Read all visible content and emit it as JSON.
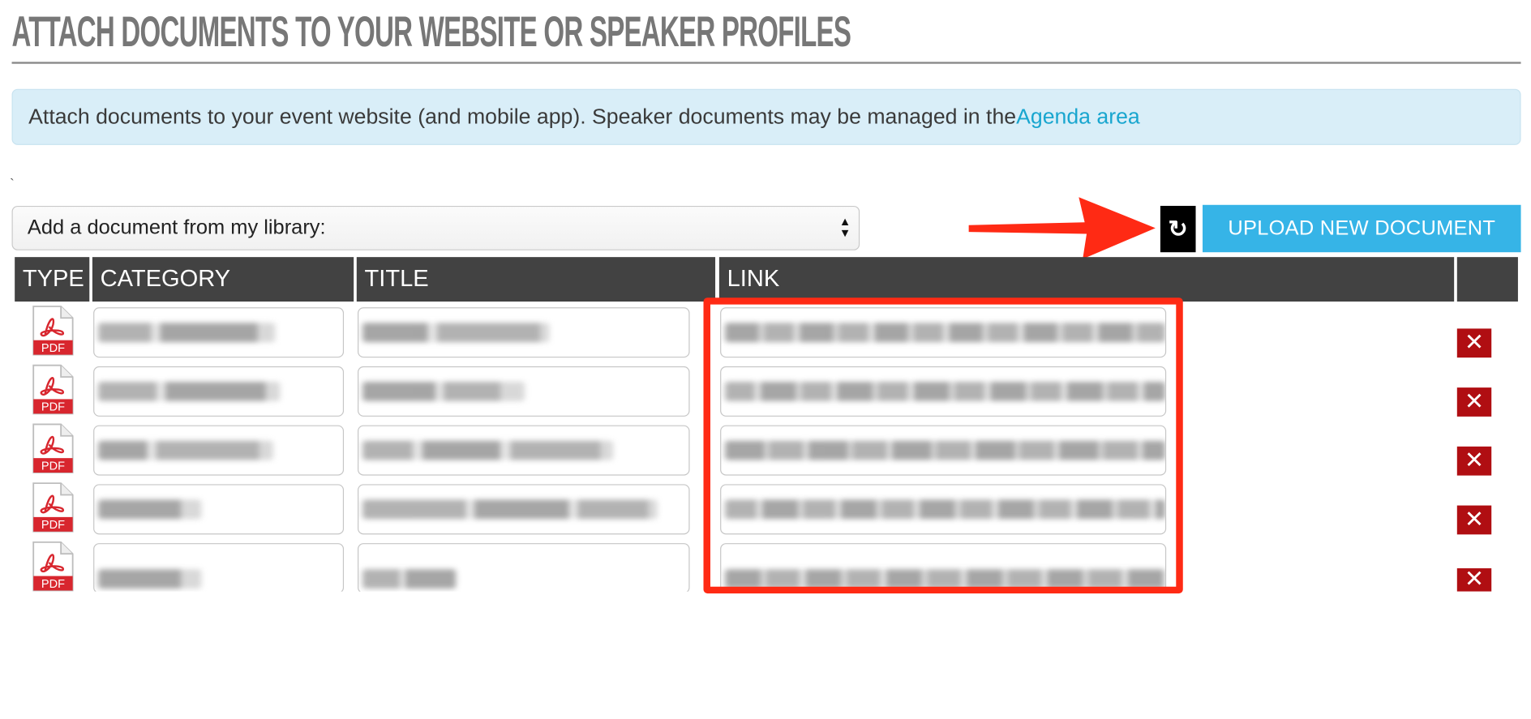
{
  "page": {
    "title": "ATTACH DOCUMENTS TO YOUR WEBSITE OR SPEAKER PROFILES"
  },
  "info": {
    "text": "Attach documents to your event website (and mobile app). Speaker documents may be managed in the ",
    "link_text": "Agenda area"
  },
  "stray_mark": "`",
  "library_select": {
    "selected": "Add a document from my library:"
  },
  "toolbar": {
    "refresh_symbol": "↻",
    "upload_label": "UPLOAD NEW DOCUMENT"
  },
  "table": {
    "columns": [
      "TYPE",
      "CATEGORY",
      "TITLE",
      "LINK",
      ""
    ],
    "rows": [
      {
        "type": "PDF",
        "delete_symbol": "✕"
      },
      {
        "type": "PDF",
        "delete_symbol": "✕"
      },
      {
        "type": "PDF",
        "delete_symbol": "✕"
      },
      {
        "type": "PDF",
        "delete_symbol": "✕"
      },
      {
        "type": "PDF",
        "delete_symbol": "✕"
      }
    ]
  },
  "colors": {
    "header_bg": "#424242",
    "upload_button": "#36b4e7",
    "info_bg": "#d9eef8",
    "link": "#19a6cf",
    "delete": "#b00e12",
    "annotation": "#ff2a14"
  },
  "icons": {
    "pdf": "pdf-file-icon",
    "refresh": "refresh-icon",
    "delete": "close-icon",
    "select": "chevron-updown-icon"
  }
}
